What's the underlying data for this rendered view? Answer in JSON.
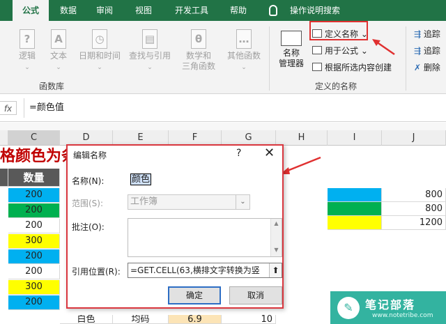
{
  "ribbon_tabs": [
    "公式",
    "数据",
    "审阅",
    "视图",
    "开发工具",
    "帮助",
    "操作说明搜索"
  ],
  "ribbon": {
    "function_buttons": [
      {
        "label": "逻辑",
        "icon": "question-mark-icon",
        "glyph": "?"
      },
      {
        "label": "文本",
        "icon": "text-a-icon",
        "glyph": "A"
      },
      {
        "label": "日期和时间",
        "icon": "clock-icon",
        "glyph": "◷"
      },
      {
        "label": "查找与引用",
        "icon": "search-book-icon",
        "glyph": "▤"
      },
      {
        "label": "数学和",
        "label2": "三角函数",
        "icon": "theta-icon",
        "glyph": "θ"
      },
      {
        "label": "其他函数",
        "icon": "more-functions-icon",
        "glyph": "…"
      }
    ],
    "function_group_label": "函数库",
    "name_manager_label1": "名称",
    "name_manager_label2": "管理器",
    "define_name": "定义名称",
    "use_in_formula": "用于公式",
    "create_from_selection": "根据所选内容创建",
    "defined_names_group_label": "定义的名称",
    "trace_precedents": "追踪",
    "trace_dependents": "追踪",
    "remove_arrows": "删除"
  },
  "formula_bar": {
    "fx": "fx",
    "content": "=颜色值"
  },
  "columns": [
    "C",
    "D",
    "E",
    "F",
    "G",
    "H",
    "I",
    "J"
  ],
  "sheet": {
    "title_fragment": "格颜色为条",
    "header_qty": "数量",
    "column_c": [
      "200",
      "200",
      "200",
      "300",
      "200",
      "200",
      "300",
      "200"
    ],
    "column_c_colors": [
      "#00b0f0",
      "#00b050",
      "#ffffff",
      "#ffff00",
      "#00b0f0",
      "#ffffff",
      "#ffff00",
      "#00b0f0"
    ],
    "column_j": [
      "800",
      "800",
      "1200"
    ],
    "column_i_colors": [
      "#00b0f0",
      "#00b050",
      "#ffff00"
    ],
    "bottom_row": [
      "白色",
      "均码",
      "6.9",
      "10"
    ]
  },
  "dialog": {
    "title": "编辑名称",
    "help": "?",
    "close": "✕",
    "name_label": "名称(N):",
    "name_value": "颜色",
    "scope_label": "范围(S):",
    "scope_value": "工作簿",
    "comment_label": "批注(O):",
    "refers_label": "引用位置(R):",
    "refers_value": "=GET.CELL(63,横排文字转换为竖",
    "ok": "确定",
    "cancel": "取消"
  },
  "watermark": {
    "title": "笔记部落",
    "subtitle": "www.notetribe.com",
    "logo_glyph": "✎"
  },
  "colors": {
    "excel_green": "#217346",
    "highlight_red": "#e03030",
    "watermark_teal": "#33b3a0"
  }
}
